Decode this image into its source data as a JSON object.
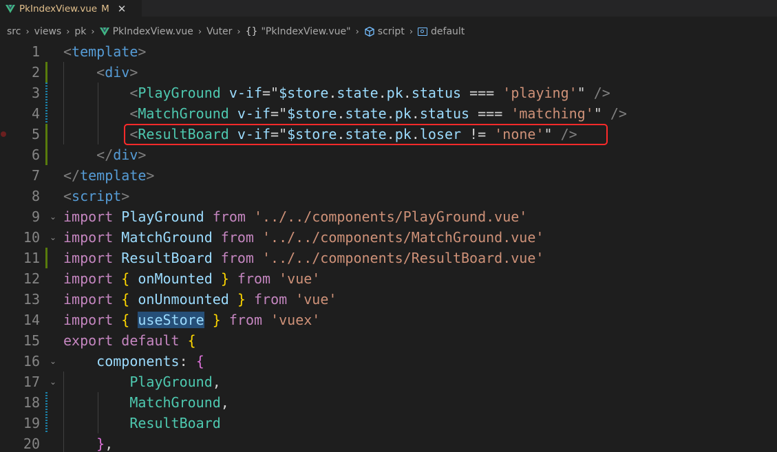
{
  "tab": {
    "name": "PkIndexView.vue",
    "modified": "M",
    "close": "✕"
  },
  "breadcrumb": {
    "items": [
      "src",
      "views",
      "pk",
      "PkIndexView.vue",
      "Vuter",
      "\"PkIndexView.vue\"",
      "script",
      "default"
    ],
    "separator": "›",
    "braces": "{}"
  },
  "colors": {
    "background": "#1e1e1e",
    "highlight_box": "#ff2a2a",
    "keyword": "#c586c0",
    "string": "#ce9178",
    "tag": "#569cd6",
    "component_tag": "#4ec9b0"
  },
  "editor": {
    "lines": [
      {
        "n": "1",
        "tokens": [
          [
            "t-punct",
            "<"
          ],
          [
            "t-tag",
            "template"
          ],
          [
            "t-punct",
            ">"
          ]
        ]
      },
      {
        "n": "2",
        "tokens": [
          [
            "t-text",
            "    "
          ],
          [
            "t-punct",
            "<"
          ],
          [
            "t-tag",
            "div"
          ],
          [
            "t-punct",
            ">"
          ]
        ]
      },
      {
        "n": "3",
        "tokens": [
          [
            "t-text",
            "        "
          ],
          [
            "t-punct",
            "<"
          ],
          [
            "t-ctag",
            "PlayGround"
          ],
          [
            "t-text",
            " "
          ],
          [
            "t-attr",
            "v-if"
          ],
          [
            "t-text",
            "=\""
          ],
          [
            "t-var",
            "$store"
          ],
          [
            "t-text",
            "."
          ],
          [
            "t-var",
            "state"
          ],
          [
            "t-text",
            "."
          ],
          [
            "t-var",
            "pk"
          ],
          [
            "t-text",
            "."
          ],
          [
            "t-var",
            "status"
          ],
          [
            "t-text",
            " === "
          ],
          [
            "t-str",
            "'playing'"
          ],
          [
            "t-text",
            "\" "
          ],
          [
            "t-punct",
            "/>"
          ]
        ]
      },
      {
        "n": "4",
        "tokens": [
          [
            "t-text",
            "        "
          ],
          [
            "t-punct",
            "<"
          ],
          [
            "t-ctag",
            "MatchGround"
          ],
          [
            "t-text",
            " "
          ],
          [
            "t-attr",
            "v-if"
          ],
          [
            "t-text",
            "=\""
          ],
          [
            "t-var",
            "$store"
          ],
          [
            "t-text",
            "."
          ],
          [
            "t-var",
            "state"
          ],
          [
            "t-text",
            "."
          ],
          [
            "t-var",
            "pk"
          ],
          [
            "t-text",
            "."
          ],
          [
            "t-var",
            "status"
          ],
          [
            "t-text",
            " === "
          ],
          [
            "t-str",
            "'matching'"
          ],
          [
            "t-text",
            "\" "
          ],
          [
            "t-punct",
            "/>"
          ]
        ]
      },
      {
        "n": "5",
        "tokens": [
          [
            "t-text",
            "        "
          ],
          [
            "t-punct",
            "<"
          ],
          [
            "t-ctag",
            "ResultBoard"
          ],
          [
            "t-text",
            " "
          ],
          [
            "t-attr",
            "v-if"
          ],
          [
            "t-text",
            "=\""
          ],
          [
            "t-var",
            "$store"
          ],
          [
            "t-text",
            "."
          ],
          [
            "t-var",
            "state"
          ],
          [
            "t-text",
            "."
          ],
          [
            "t-var",
            "pk"
          ],
          [
            "t-text",
            "."
          ],
          [
            "t-var",
            "loser"
          ],
          [
            "t-text",
            " != "
          ],
          [
            "t-str",
            "'none'"
          ],
          [
            "t-text",
            "\" "
          ],
          [
            "t-punct",
            "/>"
          ]
        ]
      },
      {
        "n": "6",
        "tokens": [
          [
            "t-text",
            "    "
          ],
          [
            "t-punct",
            "</"
          ],
          [
            "t-tag",
            "div"
          ],
          [
            "t-punct",
            ">"
          ]
        ]
      },
      {
        "n": "7",
        "tokens": [
          [
            "t-punct",
            "</"
          ],
          [
            "t-tag",
            "template"
          ],
          [
            "t-punct",
            ">"
          ]
        ]
      },
      {
        "n": "8",
        "tokens": [
          [
            "t-punct",
            "<"
          ],
          [
            "t-tag",
            "script"
          ],
          [
            "t-punct",
            ">"
          ]
        ]
      },
      {
        "n": "9",
        "tokens": [
          [
            "t-kw",
            "import"
          ],
          [
            "t-text",
            " "
          ],
          [
            "t-var",
            "PlayGround"
          ],
          [
            "t-text",
            " "
          ],
          [
            "t-kw",
            "from"
          ],
          [
            "t-text",
            " "
          ],
          [
            "t-str",
            "'../../components/PlayGround.vue'"
          ]
        ]
      },
      {
        "n": "10",
        "tokens": [
          [
            "t-kw",
            "import"
          ],
          [
            "t-text",
            " "
          ],
          [
            "t-var",
            "MatchGround"
          ],
          [
            "t-text",
            " "
          ],
          [
            "t-kw",
            "from"
          ],
          [
            "t-text",
            " "
          ],
          [
            "t-str",
            "'../../components/MatchGround.vue'"
          ]
        ]
      },
      {
        "n": "11",
        "tokens": [
          [
            "t-kw",
            "import"
          ],
          [
            "t-text",
            " "
          ],
          [
            "t-var",
            "ResultBoard"
          ],
          [
            "t-text",
            " "
          ],
          [
            "t-kw",
            "from"
          ],
          [
            "t-text",
            " "
          ],
          [
            "t-str",
            "'../../components/ResultBoard.vue'"
          ]
        ]
      },
      {
        "n": "12",
        "tokens": [
          [
            "t-kw",
            "import"
          ],
          [
            "t-text",
            " "
          ],
          [
            "t-brace1",
            "{"
          ],
          [
            "t-text",
            " "
          ],
          [
            "t-var",
            "onMounted"
          ],
          [
            "t-text",
            " "
          ],
          [
            "t-brace1",
            "}"
          ],
          [
            "t-text",
            " "
          ],
          [
            "t-kw",
            "from"
          ],
          [
            "t-text",
            " "
          ],
          [
            "t-str",
            "'vue'"
          ]
        ]
      },
      {
        "n": "13",
        "tokens": [
          [
            "t-kw",
            "import"
          ],
          [
            "t-text",
            " "
          ],
          [
            "t-brace1",
            "{"
          ],
          [
            "t-text",
            " "
          ],
          [
            "t-var",
            "onUnmounted"
          ],
          [
            "t-text",
            " "
          ],
          [
            "t-brace1",
            "}"
          ],
          [
            "t-text",
            " "
          ],
          [
            "t-kw",
            "from"
          ],
          [
            "t-text",
            " "
          ],
          [
            "t-str",
            "'vue'"
          ]
        ]
      },
      {
        "n": "14",
        "tokens": [
          [
            "t-kw",
            "import"
          ],
          [
            "t-text",
            " "
          ],
          [
            "t-brace1",
            "{"
          ],
          [
            "t-text",
            " "
          ],
          [
            "t-sel",
            "useStore"
          ],
          [
            "t-text",
            " "
          ],
          [
            "t-brace1",
            "}"
          ],
          [
            "t-text",
            " "
          ],
          [
            "t-kw",
            "from"
          ],
          [
            "t-text",
            " "
          ],
          [
            "t-str",
            "'vuex'"
          ]
        ]
      },
      {
        "n": "15",
        "tokens": [
          [
            "t-kw",
            "export"
          ],
          [
            "t-text",
            " "
          ],
          [
            "t-kw",
            "default"
          ],
          [
            "t-text",
            " "
          ],
          [
            "t-brace1",
            "{"
          ]
        ]
      },
      {
        "n": "16",
        "tokens": [
          [
            "t-text",
            "    "
          ],
          [
            "t-prop",
            "components"
          ],
          [
            "t-text",
            ": "
          ],
          [
            "t-brace2",
            "{"
          ]
        ]
      },
      {
        "n": "17",
        "tokens": [
          [
            "t-text",
            "        "
          ],
          [
            "t-cls",
            "PlayGround"
          ],
          [
            "t-text",
            ","
          ]
        ]
      },
      {
        "n": "18",
        "tokens": [
          [
            "t-text",
            "        "
          ],
          [
            "t-cls",
            "MatchGround"
          ],
          [
            "t-text",
            ","
          ]
        ]
      },
      {
        "n": "19",
        "tokens": [
          [
            "t-text",
            "        "
          ],
          [
            "t-cls",
            "ResultBoard"
          ]
        ]
      },
      {
        "n": "20",
        "tokens": [
          [
            "t-text",
            "    "
          ],
          [
            "t-brace2",
            "}"
          ],
          [
            "t-text",
            ","
          ]
        ]
      }
    ]
  }
}
